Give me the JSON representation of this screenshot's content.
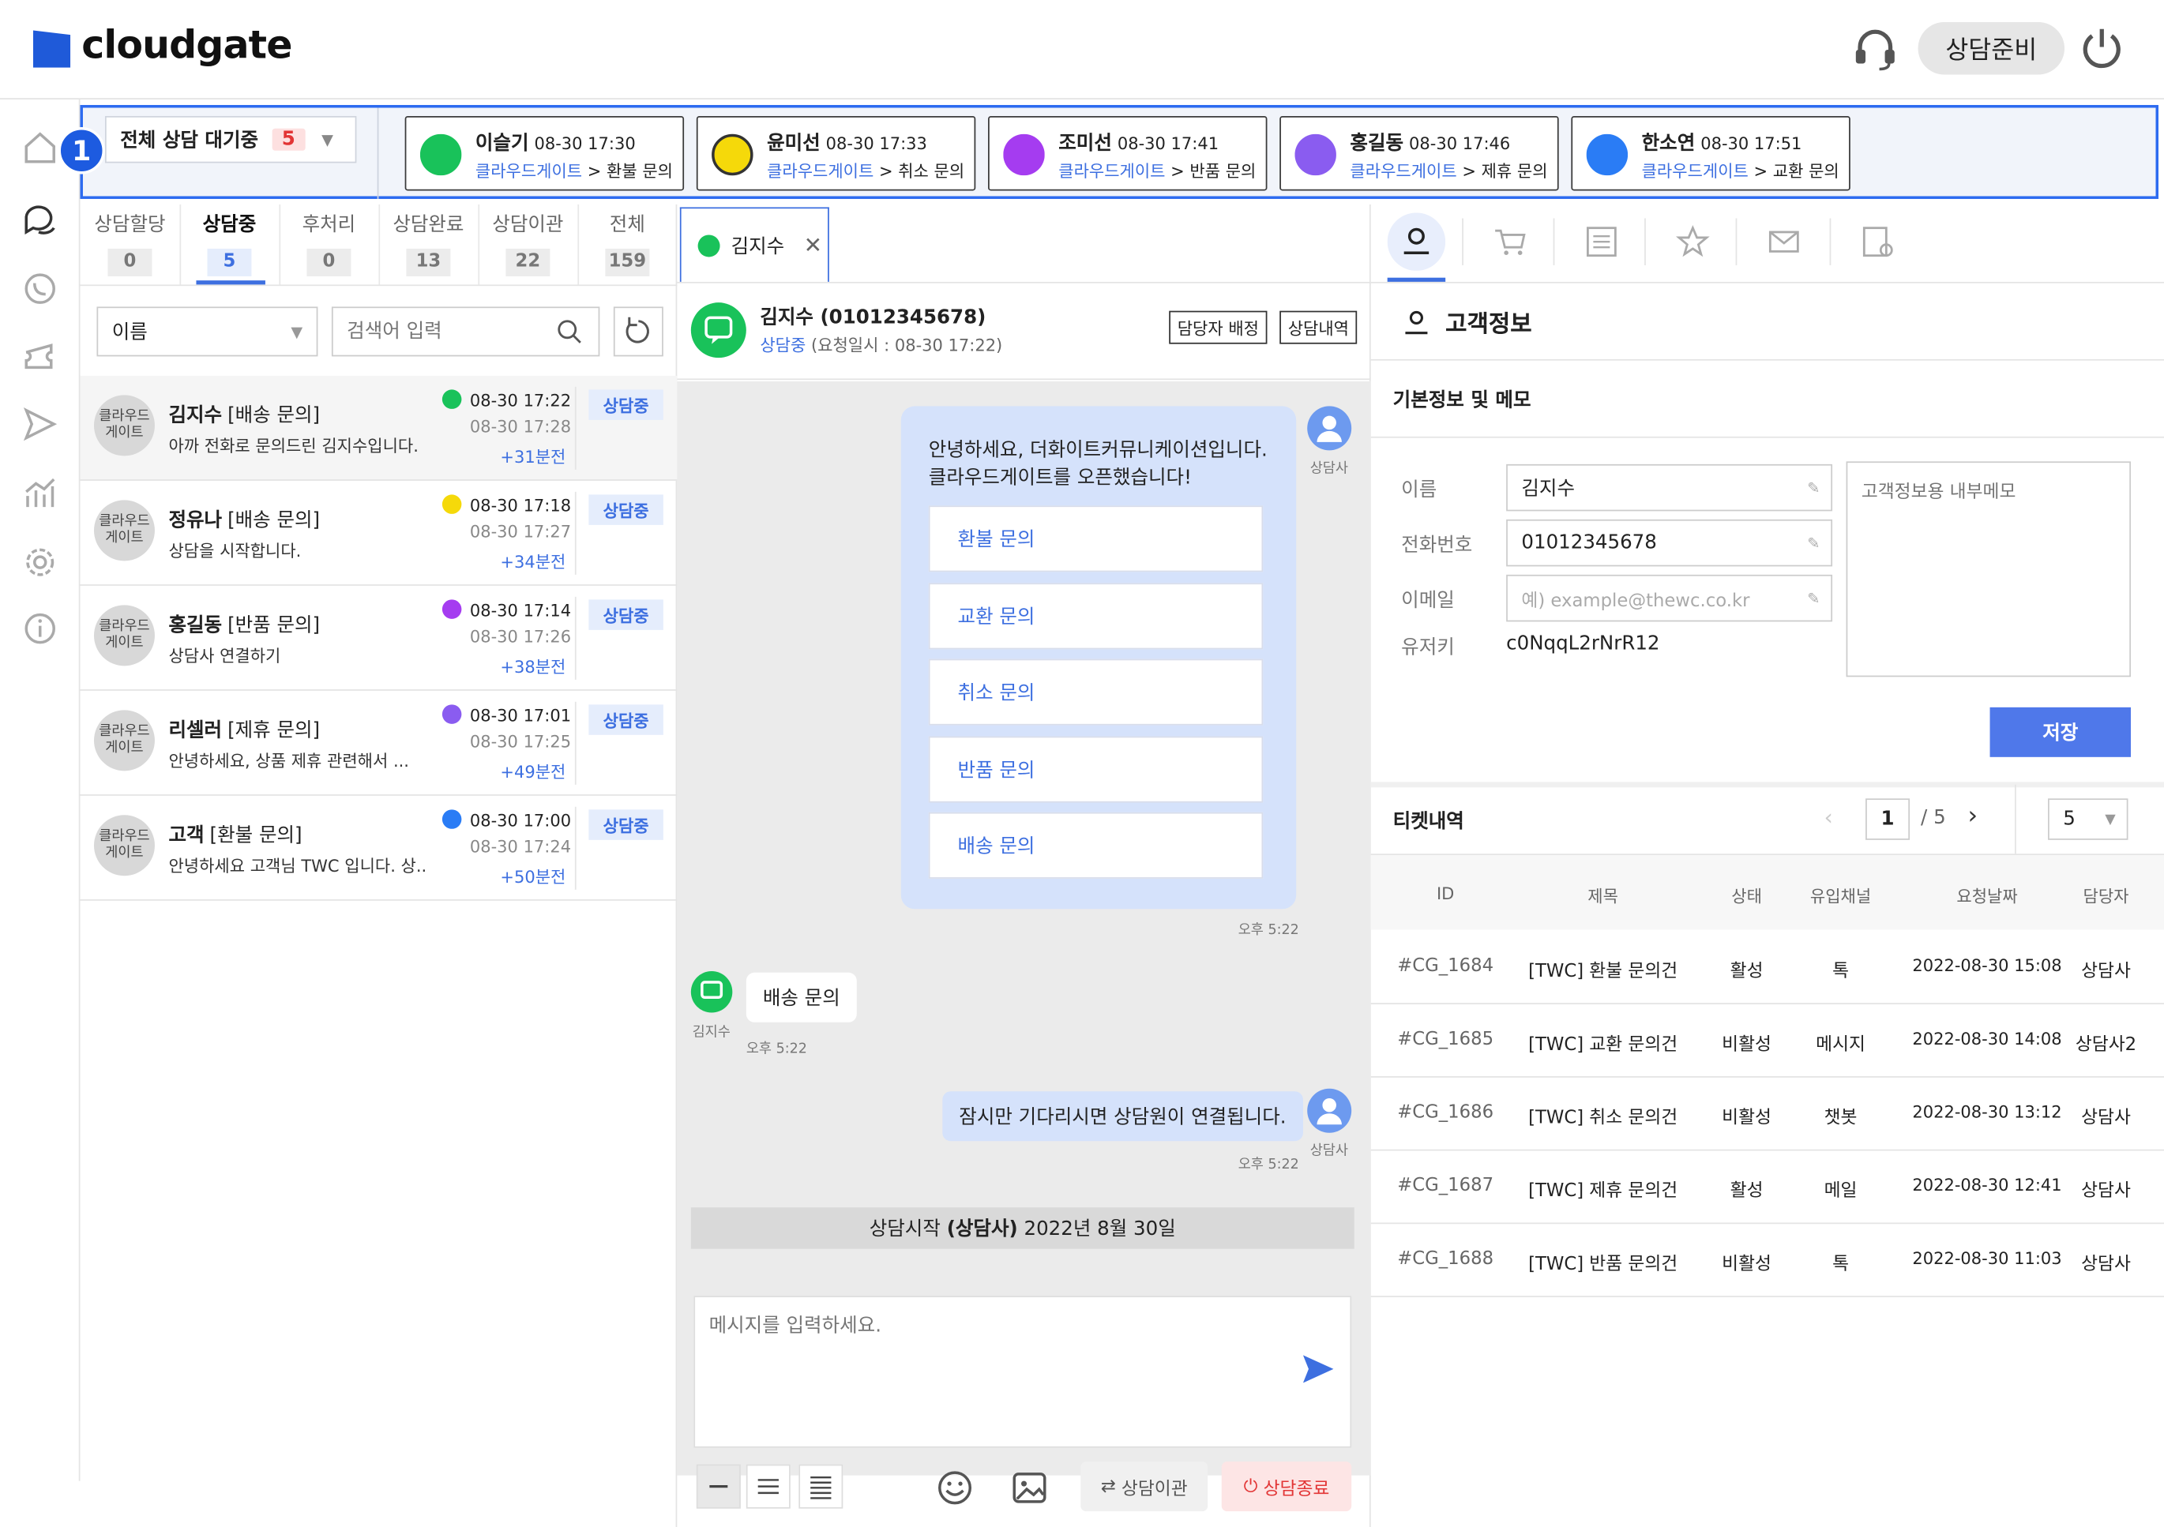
{
  "header": {
    "logo": "cloudgate",
    "ready_btn": "상담준비"
  },
  "waiting": {
    "label": "전체 상담 대기중",
    "count": "5",
    "cards": [
      {
        "name": "이슬기",
        "time": "08-30 17:30",
        "src": "클라우드게이트",
        "cat": "환불 문의",
        "color": "#19c25a"
      },
      {
        "name": "윤미선",
        "time": "08-30 17:33",
        "src": "클라우드게이트",
        "cat": "취소 문의",
        "color": "#f5d90a"
      },
      {
        "name": "조미선",
        "time": "08-30 17:41",
        "src": "클라우드게이트",
        "cat": "반품 문의",
        "color": "#a53cf0"
      },
      {
        "name": "홍길동",
        "time": "08-30 17:46",
        "src": "클라우드게이트",
        "cat": "제휴 문의",
        "color": "#8a5cf0"
      },
      {
        "name": "한소연",
        "time": "08-30 17:51",
        "src": "클라우드게이트",
        "cat": "교환 문의",
        "color": "#2a7cf5"
      }
    ],
    "badge": "1"
  },
  "tabs": [
    {
      "label": "상담할당",
      "count": "0"
    },
    {
      "label": "상담중",
      "count": "5"
    },
    {
      "label": "후처리",
      "count": "0"
    },
    {
      "label": "상담완료",
      "count": "13"
    },
    {
      "label": "상담이관",
      "count": "22"
    },
    {
      "label": "전체",
      "count": "159"
    }
  ],
  "filter": {
    "select": "이름",
    "search_placeholder": "검색어 입력"
  },
  "chats": [
    {
      "avatar": "클라우드\n게이트",
      "name": "김지수",
      "cat": "[배송 문의]",
      "msg": "아까 전화로 문의드린 김지수입니다.",
      "t1": "08-30 17:22",
      "t2": "08-30 17:28",
      "t3": "+31분전",
      "status": "상담중",
      "color": "#19c25a"
    },
    {
      "avatar": "클라우드\n게이트",
      "name": "정유나",
      "cat": "[배송 문의]",
      "msg": "상담을 시작합니다.",
      "t1": "08-30 17:18",
      "t2": "08-30 17:27",
      "t3": "+34분전",
      "status": "상담중",
      "color": "#f5d90a"
    },
    {
      "avatar": "클라우드\n게이트",
      "name": "홍길동",
      "cat": "[반품 문의]",
      "msg": "상담사 연결하기",
      "t1": "08-30 17:14",
      "t2": "08-30 17:26",
      "t3": "+38분전",
      "status": "상담중",
      "color": "#a53cf0"
    },
    {
      "avatar": "클라우드\n게이트",
      "name": "리셀러",
      "cat": "[제휴 문의]",
      "msg": "안녕하세요, 상품 제휴 관련해서 ...",
      "t1": "08-30 17:01",
      "t2": "08-30 17:25",
      "t3": "+49분전",
      "status": "상담중",
      "color": "#8a5cf0"
    },
    {
      "avatar": "클라우드\n게이트",
      "name": "고객",
      "cat": "[환불 문의]",
      "msg": "안녕하세요 고객님 TWC 입니다. 상..",
      "t1": "08-30 17:00",
      "t2": "08-30 17:24",
      "t3": "+50분전",
      "status": "상담중",
      "color": "#2a7cf5"
    }
  ],
  "chat": {
    "tab": "김지수",
    "title": "김지수 (01012345678)",
    "status": "상담중",
    "req": "(요청일시 : 08-30 17:22)",
    "assign_btn": "담당자 배정",
    "history_btn": "상담내역",
    "greeting1": "안녕하세요, 더화이트커뮤니케이션입니다.",
    "greeting2": "클라우드게이트를 오픈했습니다!",
    "options": [
      "환불 문의",
      "교환 문의",
      "취소 문의",
      "반품 문의",
      "배송 문의"
    ],
    "agent_label": "상담사",
    "time1": "오후 5:22",
    "customer_label": "김지수",
    "customer_msg": "배송 문의",
    "time2": "오후 5:22",
    "wait_msg": "잠시만 기다리시면 상담원이 연결됩니다.",
    "time3": "오후 5:22",
    "start_prefix": "상담시작",
    "start_agent": "(상담사)",
    "start_date": "2022년 8월 30일",
    "input_placeholder": "메시지를 입력하세요.",
    "transfer_btn": "상담이관",
    "end_btn": "상담종료"
  },
  "customer": {
    "title": "고객정보",
    "section": "기본정보 및 메모",
    "name_label": "이름",
    "name": "김지수",
    "phone_label": "전화번호",
    "phone": "01012345678",
    "email_label": "이메일",
    "email_placeholder": "예) example@thewc.co.kr",
    "userkey_label": "유저키",
    "userkey": "c0NqqL2rNrR12",
    "memo_placeholder": "고객정보용 내부메모",
    "save": "저장"
  },
  "tickets": {
    "title": "티켓내역",
    "page": "1",
    "total": "/ 5",
    "per_page": "5",
    "headers": [
      "ID",
      "제목",
      "상태",
      "유입채널",
      "요청날짜",
      "담당자"
    ],
    "rows": [
      [
        "#CG_1684",
        "[TWC] 환불 문의건",
        "활성",
        "톡",
        "2022-08-30 15:08",
        "상담사"
      ],
      [
        "#CG_1685",
        "[TWC] 교환 문의건",
        "비활성",
        "메시지",
        "2022-08-30 14:08",
        "상담사2"
      ],
      [
        "#CG_1686",
        "[TWC] 취소 문의건",
        "비활성",
        "챗봇",
        "2022-08-30 13:12",
        "상담사"
      ],
      [
        "#CG_1687",
        "[TWC] 제휴 문의건",
        "활성",
        "메일",
        "2022-08-30 12:41",
        "상담사"
      ],
      [
        "#CG_1688",
        "[TWC] 반품 문의건",
        "비활성",
        "톡",
        "2022-08-30 11:03",
        "상담사"
      ]
    ]
  }
}
